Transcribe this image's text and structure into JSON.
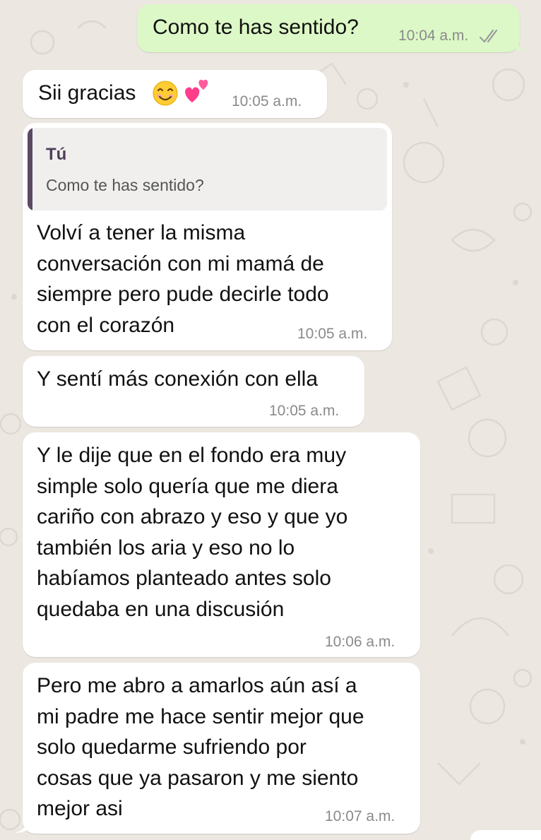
{
  "colors": {
    "background": "#ece8e1",
    "incoming_bubble": "#ffffff",
    "outgoing_bubble": "#dcf8c6",
    "timestamp": "#8a8a8a",
    "quote_bar": "#5b4a63",
    "quote_author": "#4f3e59"
  },
  "messages": [
    {
      "direction": "outgoing",
      "text": "Como te has sentido?",
      "time": "10:04 a.m.",
      "status_icon": "double-check-icon"
    },
    {
      "direction": "incoming",
      "text": "Sii gracias",
      "emojis": [
        "smiling-face-icon",
        "two-hearts-icon"
      ],
      "time": "10:05 a.m."
    },
    {
      "direction": "incoming",
      "reply_to": {
        "author": "Tú",
        "text": "Como te has sentido?"
      },
      "text": "Volví a tener la misma\nconversación con mi mamá de\nsiempre pero pude decirle todo\ncon el corazón",
      "time": "10:05 a.m."
    },
    {
      "direction": "incoming",
      "text": "Y sentí más conexión con ella",
      "time": "10:05 a.m."
    },
    {
      "direction": "incoming",
      "text": "Y le dije que en el fondo era muy\nsimple solo quería que me diera\ncariño con abrazo y eso y que yo\ntambién los aria y eso no lo\nhabíamos planteado antes solo\nquedaba en una discusión",
      "time": "10:06 a.m."
    },
    {
      "direction": "incoming",
      "text": "Pero me abro a amarlos aún así a\nmi padre me hace sentir mejor que\nsolo quedarme sufriendo por\ncosas que ya pasaron y me siento\nmejor asi",
      "time": "10:07 a.m."
    }
  ]
}
